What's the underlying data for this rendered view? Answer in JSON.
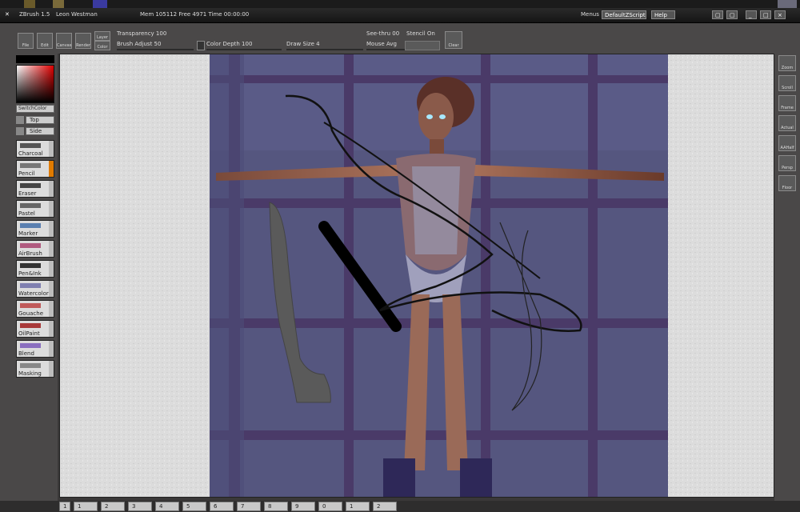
{
  "system_bar": {
    "icons": [
      "app-icon",
      "app-icon",
      "app-icon"
    ]
  },
  "title_bar": {
    "app_title": "ZBrush 1.5",
    "user": "Leon Westman",
    "status": "Mem 105112 Free 4971 Time 00:00:00",
    "menus_label": "Menus",
    "script_label": "DefaultZScript",
    "help_label": "Help",
    "window_buttons": [
      "▢",
      "▢",
      "_",
      "□",
      "×"
    ]
  },
  "toolbar": {
    "buttons": [
      "File",
      "Edit",
      "Canvas",
      "Render",
      "Layer",
      "Color"
    ],
    "transparency": "Transparency 100",
    "brush_adjust": "Brush Adjust 50",
    "color_depth": "Color Depth 100",
    "draw_size": "Draw Size 4",
    "see_thru": "See-thru 00",
    "stencil": "Stencil On",
    "mouse_avg": "Mouse Avg",
    "clear_label": "Clear"
  },
  "left_panel": {
    "switch_color": "SwitchColor",
    "top_button": "Top",
    "side_button": "Side",
    "brushes": [
      {
        "label": "Charcoal",
        "color": "#555555"
      },
      {
        "label": "Pencil",
        "color": "#777777"
      },
      {
        "label": "Eraser",
        "color": "#444444"
      },
      {
        "label": "Pastel",
        "color": "#666666"
      },
      {
        "label": "Marker",
        "color": "#5a7fb0"
      },
      {
        "label": "AirBrush",
        "color": "#b05a7f"
      },
      {
        "label": "Pen&Ink",
        "color": "#333333"
      },
      {
        "label": "Watercolor",
        "color": "#7f7fb0"
      },
      {
        "label": "Gouache",
        "color": "#c05a5a"
      },
      {
        "label": "OilPaint",
        "color": "#a83a3a"
      },
      {
        "label": "Blend",
        "color": "#8a6fbf"
      },
      {
        "label": "Masking",
        "color": "#888888"
      }
    ],
    "accent_color": "#e07b00"
  },
  "right_panel": {
    "buttons": [
      "Zoom",
      "Scroll",
      "Frame",
      "Actual",
      "AAHalf",
      "Persp",
      "Floor"
    ]
  },
  "bottom_bar": {
    "tabs": [
      "1",
      "1",
      "2",
      "3",
      "4",
      "5",
      "6",
      "7",
      "8",
      "9",
      "0",
      "1",
      "2"
    ]
  }
}
